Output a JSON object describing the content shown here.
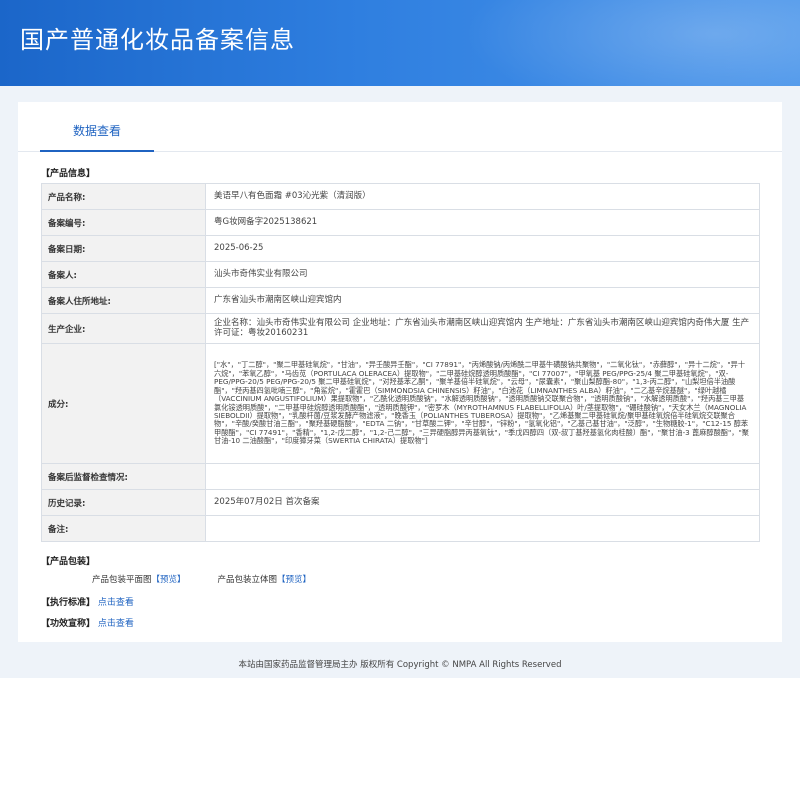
{
  "header": {
    "title": "国产普通化妆品备案信息"
  },
  "tabs": [
    {
      "label": "数据查看"
    }
  ],
  "product_info": {
    "section_title": "【产品信息】",
    "rows": [
      {
        "label": "产品名称:",
        "value": "美语早八有色面霜 #03沁光紫（清润版）"
      },
      {
        "label": "备案编号:",
        "value": "粤G妆网备字2025138621"
      },
      {
        "label": "备案日期:",
        "value": "2025-06-25"
      },
      {
        "label": "备案人:",
        "value": "汕头市奇伟实业有限公司"
      },
      {
        "label": "备案人住所地址:",
        "value": "广东省汕头市潮南区峡山迎宾馆内"
      },
      {
        "label": "生产企业:",
        "value": "企业名称：汕头市奇伟实业有限公司 企业地址：广东省汕头市潮南区峡山迎宾馆内 生产地址：广东省汕头市潮南区峡山迎宾馆内奇伟大厦 生产许可证：粤妆20160231"
      },
      {
        "label": "成分:",
        "value": "[\"水\"，\"丁二醇\"，\"聚二甲基硅氧烷\"，\"甘油\"，\"异壬酸异壬酯\"，\"CI 77891\"，\"丙烯酸钠/丙烯酰二甲基牛磺酸钠共聚物\"，\"二氧化钛\"，\"赤藓醇\"，\"异十二烷\"，\"异十六烷\"，\"苯氧乙醇\"，\"马齿苋（PORTULACA OLERACEA）提取物\"，\"二甲基硅烷醇透明质酸酯\"，\"CI 77007\"，\"甲氧基 PEG/PPG-25/4 聚二甲基硅氧烷\"，\"双-PEG/PPG-20/5 PEG/PPG-20/5 聚二甲基硅氧烷\"，\"对羟基苯乙酮\"，\"聚羊基倍半硅氧烷\"，\"云母\"，\"尿囊素\"，\"聚山梨醇酯-80\"，\"1,3-丙二醇\"，\"山梨坦倍半油酸酯\"，\"羟丙基四氢吡喃三醇\"，\"角鲨烷\"，\"霍霍巴（SIMMONDSIA CHINENSIS）籽油\"，\"白池花（LIMNANTHES ALBA）籽油\"，\"二乙基辛烷基醚\"，\"绿叶越橘（VACCINIUM ANGUSTIFOLIUM）果提取物\"，\"乙酰化透明质酸钠\"，\"水解透明质酸钠\"，\"透明质酸钠交联聚合物\"，\"透明质酸钠\"，\"水解透明质酸\"，\"羟丙基三甲基氯化铵透明质酸\"，\"二甲基甲硅烷醇透明质酸酯\"，\"透明质酸钾\"，\"密罗木（MYROTHAMNUS FLABELLIFOLIA）叶/茎提取物\"，\"硼硅酸钠\"，\"天女木兰（MAGNOLIA SIEBOLDII）提取物\"，\"乳酸杆菌/豆浆发酵产物滤液\"，\"晚香玉（POLIANTHES TUBEROSA）提取物\"，\"乙烯基聚二甲基硅氧烷/聚甲基硅氧烷倍半硅氧烷交联聚合物\"，\"辛酸/癸酸甘油三酯\"，\"聚羟基硬脂酸\"，\"EDTA 二钠\"，\"甘草酸二钾\"，\"辛甘醇\"，\"锌粉\"，\"氢氧化铝\"，\"乙基己基甘油\"，\"泛醇\"，\"生物糖胶-1\"，\"C12-15 醇苯甲酸酯\"，\"CI 77491\"，\"香精\"，\"1,2-戊二醇\"，\"1,2-己二醇\"，\"三异硬脂醇异丙基氧钛\"，\"季戊四醇四（双-叔丁基羟基氢化肉桂酸）酯\"，\"聚甘油-3 蓖麻醇酸酯\"，\"聚甘油-10 二油酸酯\"，\"印度獐牙菜（SWERTIA CHIRATA）提取物\"]"
      },
      {
        "label": "备案后监督检查情况:",
        "value": ""
      },
      {
        "label": "历史记录:",
        "value": "2025年07月02日 首次备案"
      },
      {
        "label": "备注:",
        "value": ""
      }
    ]
  },
  "packaging": {
    "section_title": "【产品包装】",
    "flat_label": "产品包装平面图",
    "flat_link": "【预览】",
    "three_d_label": "产品包装立体图",
    "three_d_link": "【预览】"
  },
  "standard": {
    "section_title": "【执行标准】",
    "link": "点击查看"
  },
  "efficacy": {
    "section_title": "【功效宣称】",
    "link": "点击查看"
  },
  "footer": {
    "text": "本站由国家药品监督管理局主办 版权所有 Copyright © NMPA All Rights Reserved"
  }
}
